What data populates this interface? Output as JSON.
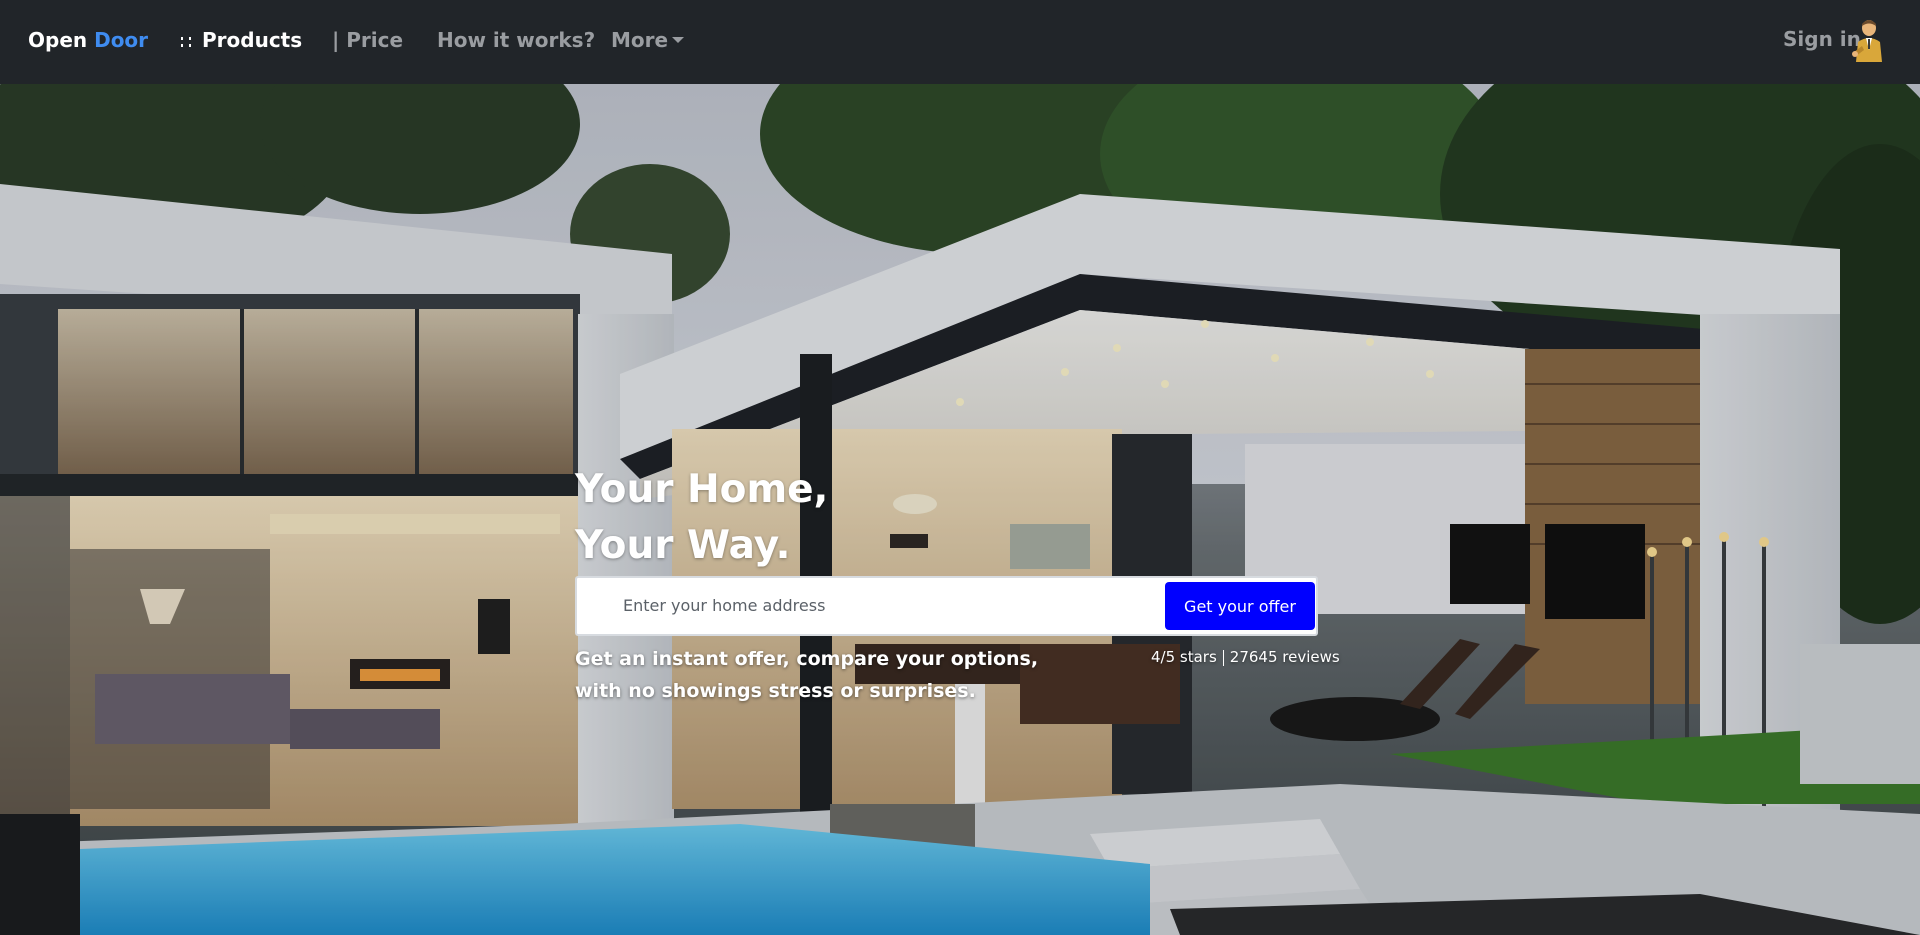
{
  "navbar": {
    "brand_part1": "Open",
    "brand_part2": "Door",
    "products_label": "Products",
    "price_label": "| Price",
    "how_label": "How it works?",
    "more_label": "More",
    "signin_label": "Sign in",
    "icons": {
      "products": "grid-dots-icon",
      "more": "caret-down-icon",
      "avatar": "user-avatar-icon"
    }
  },
  "hero": {
    "title_line1": "Your Home,",
    "title_line2": "Your Way.",
    "search_placeholder": "Enter your home address",
    "offer_button": "Get your offer",
    "tagline_line1": "Get an instant offer, compare your options,",
    "tagline_line2": "with no showings stress or surprises.",
    "rating": "4/5 stars",
    "reviews": "27645 reviews"
  },
  "colors": {
    "navbar_bg": "#212529",
    "brand_accent": "#3f8cf0",
    "button_bg": "#0000ff",
    "nav_muted": "#9a9da1"
  }
}
